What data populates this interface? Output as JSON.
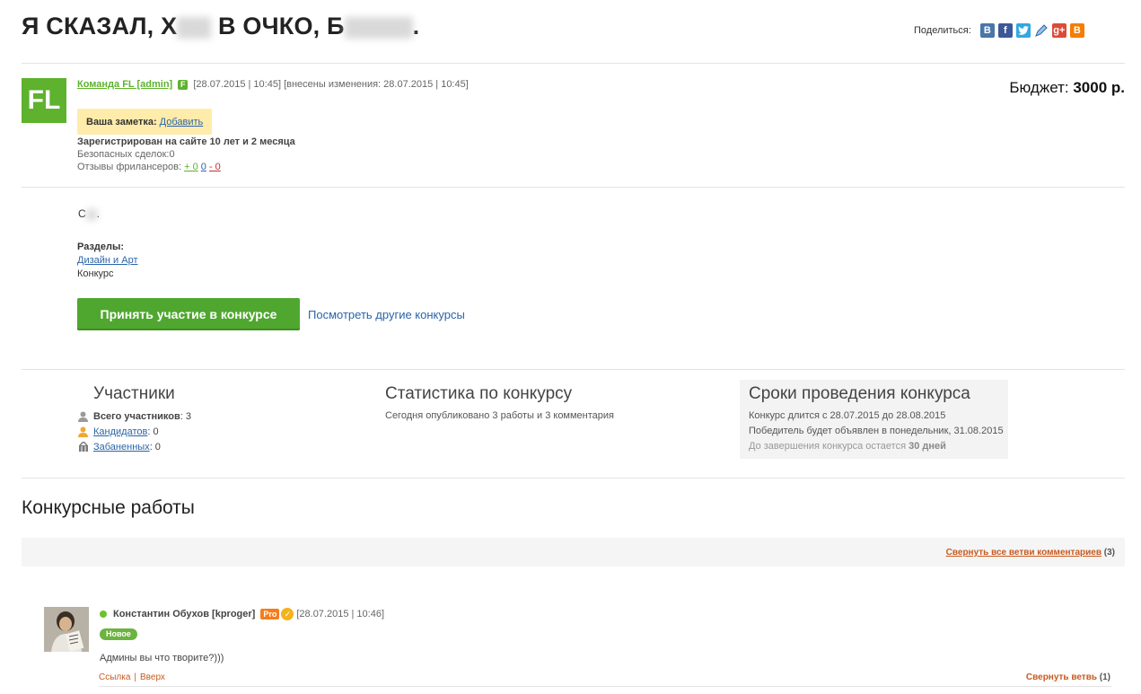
{
  "header": {
    "title_part1": "Я СКАЗАЛ, Х",
    "title_part2": " В ОЧКО, Б",
    "title_part3": ".",
    "share_label": "Поделиться:",
    "share_icons": [
      "vk-icon",
      "facebook-icon",
      "twitter-icon",
      "livejournal-icon",
      "googleplus-icon",
      "blogger-icon"
    ]
  },
  "author": {
    "avatar_text": "FL",
    "name": "Команда FL [admin]",
    "badge": "F",
    "date": "[28.07.2015 | 10:45]",
    "modified": "[внесены изменения: 28.07.2015 | 10:45]"
  },
  "budget": {
    "label": "Бюджет:",
    "value": "3000 р."
  },
  "note": {
    "label": "Ваша заметка:",
    "add_link": "Добавить"
  },
  "stats": {
    "registered": "Зарегистрирован на сайте 10 лет и 2 месяца",
    "safe_deals": "Безопасных сделок:0",
    "reviews_label": "Отзывы фрилансеров:",
    "reviews_pos": "+ 0",
    "reviews_neu": "0",
    "reviews_neg": "- 0"
  },
  "description": {
    "text_start": "С",
    "text_end": "."
  },
  "sections": {
    "heading": "Разделы:",
    "category_link": "Дизайн и Арт",
    "category_kind": "Конкурс"
  },
  "actions": {
    "participate_button": "Принять участие в конкурсе",
    "other_contests_link": "Посмотреть другие конкурсы"
  },
  "participants": {
    "heading": "Участники",
    "total_label": "Всего участников",
    "total_value": ": 3",
    "candidates_label": "Кандидатов",
    "candidates_value": ": 0",
    "banned_label": "Забаненных",
    "banned_value": ": 0"
  },
  "contest_stats": {
    "heading": "Статистика по конкурсу",
    "text": "Сегодня опубликовано 3 работы и 3 комментария"
  },
  "terms": {
    "heading": "Сроки проведения конкурса",
    "duration": "Конкурс длится с 28.07.2015 до 28.08.2015",
    "winner": "Победитель будет объявлен в понедельник, 31.08.2015",
    "remaining_label": "До завершения конкурса остается",
    "remaining_value": "30 дней"
  },
  "works": {
    "heading": "Конкурсные работы",
    "collapse_all_link": "Свернуть все ветви комментариев",
    "collapse_all_count": "(3)"
  },
  "comment": {
    "author": "Константин Обухов [kproger]",
    "pro_badge": "Pro",
    "verified_mark": "✓",
    "date": "[28.07.2015 | 10:46]",
    "new_badge": "Новое",
    "text": "Админы вы что творите?)))",
    "link_label": "Ссылка",
    "separator": "|",
    "up_label": "Вверх",
    "collapse_link": "Свернуть ветвь",
    "collapse_count": "(1)"
  },
  "colors": {
    "brand_green": "#5eb22e",
    "button_green": "#4fa72f",
    "link_blue": "#2a64a8",
    "accent_orange": "#c85a1f",
    "note_yellow": "#ffecaa"
  }
}
